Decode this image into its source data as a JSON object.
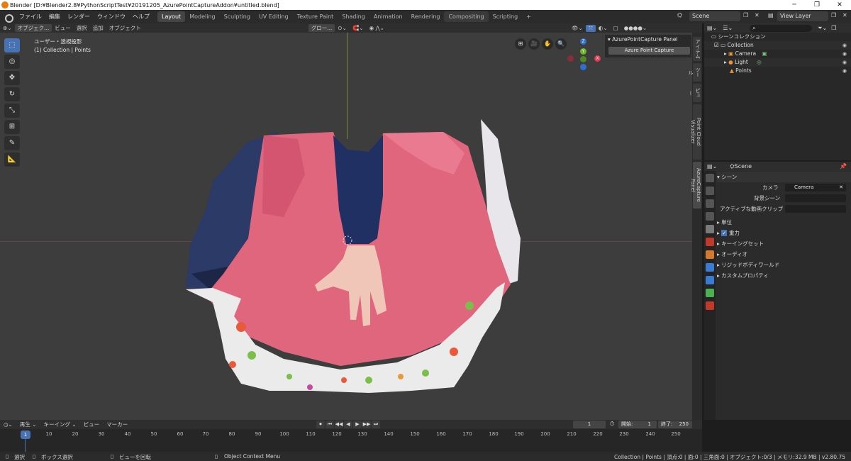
{
  "window": {
    "title": "Blender [D:¥Blender2.8¥PythonScriptTest¥20191205_AzurePointCaptureAddon¥untitled.blend]",
    "minimize": "─",
    "maximize": "❐",
    "close": "✕"
  },
  "menu": [
    "ファイル",
    "編集",
    "レンダー",
    "ウィンドウ",
    "ヘルプ"
  ],
  "workspaces": [
    "Layout",
    "Modeling",
    "Sculpting",
    "UV Editing",
    "Texture Paint",
    "Shading",
    "Animation",
    "Rendering",
    "Compositing",
    "Scripting",
    "+"
  ],
  "topbar": {
    "scene": "Scene",
    "view_layer": "View Layer"
  },
  "viewport_header": {
    "mode": "オブジェク...",
    "items": [
      "ビュー",
      "選択",
      "追加",
      "オブジェクト"
    ],
    "transform": "グロー..."
  },
  "viewport": {
    "view_name": "ユーザー・透視投影",
    "context": "(1) Collection | Points"
  },
  "tools": [
    "⬚",
    "◎",
    "✥",
    "↻",
    "⤡",
    "⊞",
    "✎",
    "📐"
  ],
  "nav_icons": [
    "⊞",
    "🎥",
    "✋",
    "🔍"
  ],
  "gizmo": {
    "z": "Z",
    "y": "Y",
    "x": "X"
  },
  "npanel": {
    "title": "▾ AzurePointCapture Panel",
    "button": "Azure Point Capture"
  },
  "side_tabs": [
    "アイテム",
    "ツール",
    "ビュー",
    "Point Cloud Visualizer",
    "AzureCapture Panel"
  ],
  "outliner": {
    "rows": [
      {
        "label": "シーンコレクション"
      },
      {
        "label": "Collection"
      },
      {
        "label": "Camera"
      },
      {
        "label": "Light"
      },
      {
        "label": "Points"
      }
    ]
  },
  "properties": {
    "scene_name": "Scene",
    "section": "シーン",
    "camera_label": "カメラ",
    "camera_value": "Camera",
    "bg_scene_label": "背景シーン",
    "clip_label": "アクティブな動画クリップ",
    "panels": [
      "単位",
      "重力",
      "キーイングセット",
      "オーディオ",
      "リジッドボディワールド",
      "カスタムプロパティ"
    ]
  },
  "timeline": {
    "menu": [
      "再生 ⌄",
      "キーイング ⌄",
      "ビュー",
      "マーカー"
    ],
    "play_buttons": [
      "⏺",
      "⏮",
      "◀◀",
      "◀",
      "▶",
      "▶▶",
      "⏭"
    ],
    "current_frame": "1",
    "start_label": "開始:",
    "start": "1",
    "end_label": "終了:",
    "end": "250",
    "ticks": [
      "10",
      "20",
      "30",
      "40",
      "50",
      "60",
      "70",
      "80",
      "90",
      "100",
      "110",
      "120",
      "130",
      "140",
      "150",
      "160",
      "170",
      "180",
      "190",
      "200",
      "210",
      "220",
      "230",
      "240",
      "250"
    ],
    "marker_frame": "1"
  },
  "status": {
    "select": "選択",
    "box_select": "ボックス選択",
    "rotate_view": "ビューを回転",
    "context_menu": "Object Context Menu",
    "info": "Collection | Points | 頂点:0 | 面:0 | 三角面:0 | オブジェクト:0/3 | メモリ:32.9 MB | v2.80.75"
  },
  "colors": {
    "accent": "#4772b3",
    "sweater": "#e0667e",
    "jeans": "#2b3a66",
    "shirt": "#213063",
    "towel": "#ecebec"
  }
}
